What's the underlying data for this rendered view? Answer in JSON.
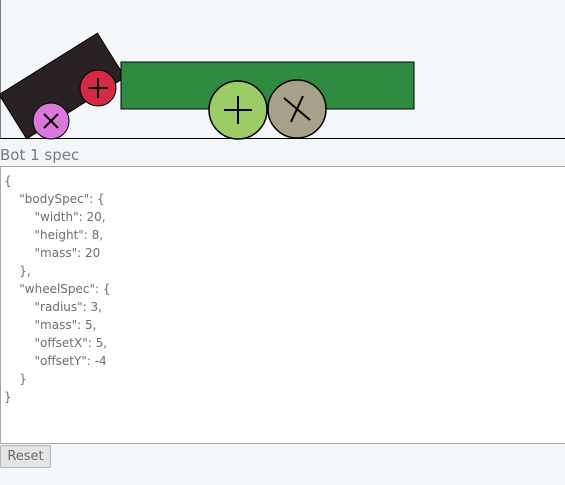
{
  "spec": {
    "heading": "Bot 1 spec",
    "json_text": "{\n    \"bodySpec\": {\n        \"width\": 20,\n        \"height\": 8,\n        \"mass\": 20\n    },\n    \"wheelSpec\": {\n        \"radius\": 3,\n        \"mass\": 5,\n        \"offsetX\": 5,\n        \"offsetY\": -4\n    }\n}"
  },
  "controls": {
    "reset_label": "Reset"
  },
  "colors": {
    "ground_line": "#000000",
    "sim_background": "#f4f7fa",
    "bot1_body": "#2a2124",
    "bot1_wheel_front": "#d52a46",
    "bot1_wheel_rear": "#db78db",
    "bot2_body": "#2e8b3f",
    "bot2_wheel_front": "#9ccc65",
    "bot2_wheel_rear": "#a8a189"
  }
}
